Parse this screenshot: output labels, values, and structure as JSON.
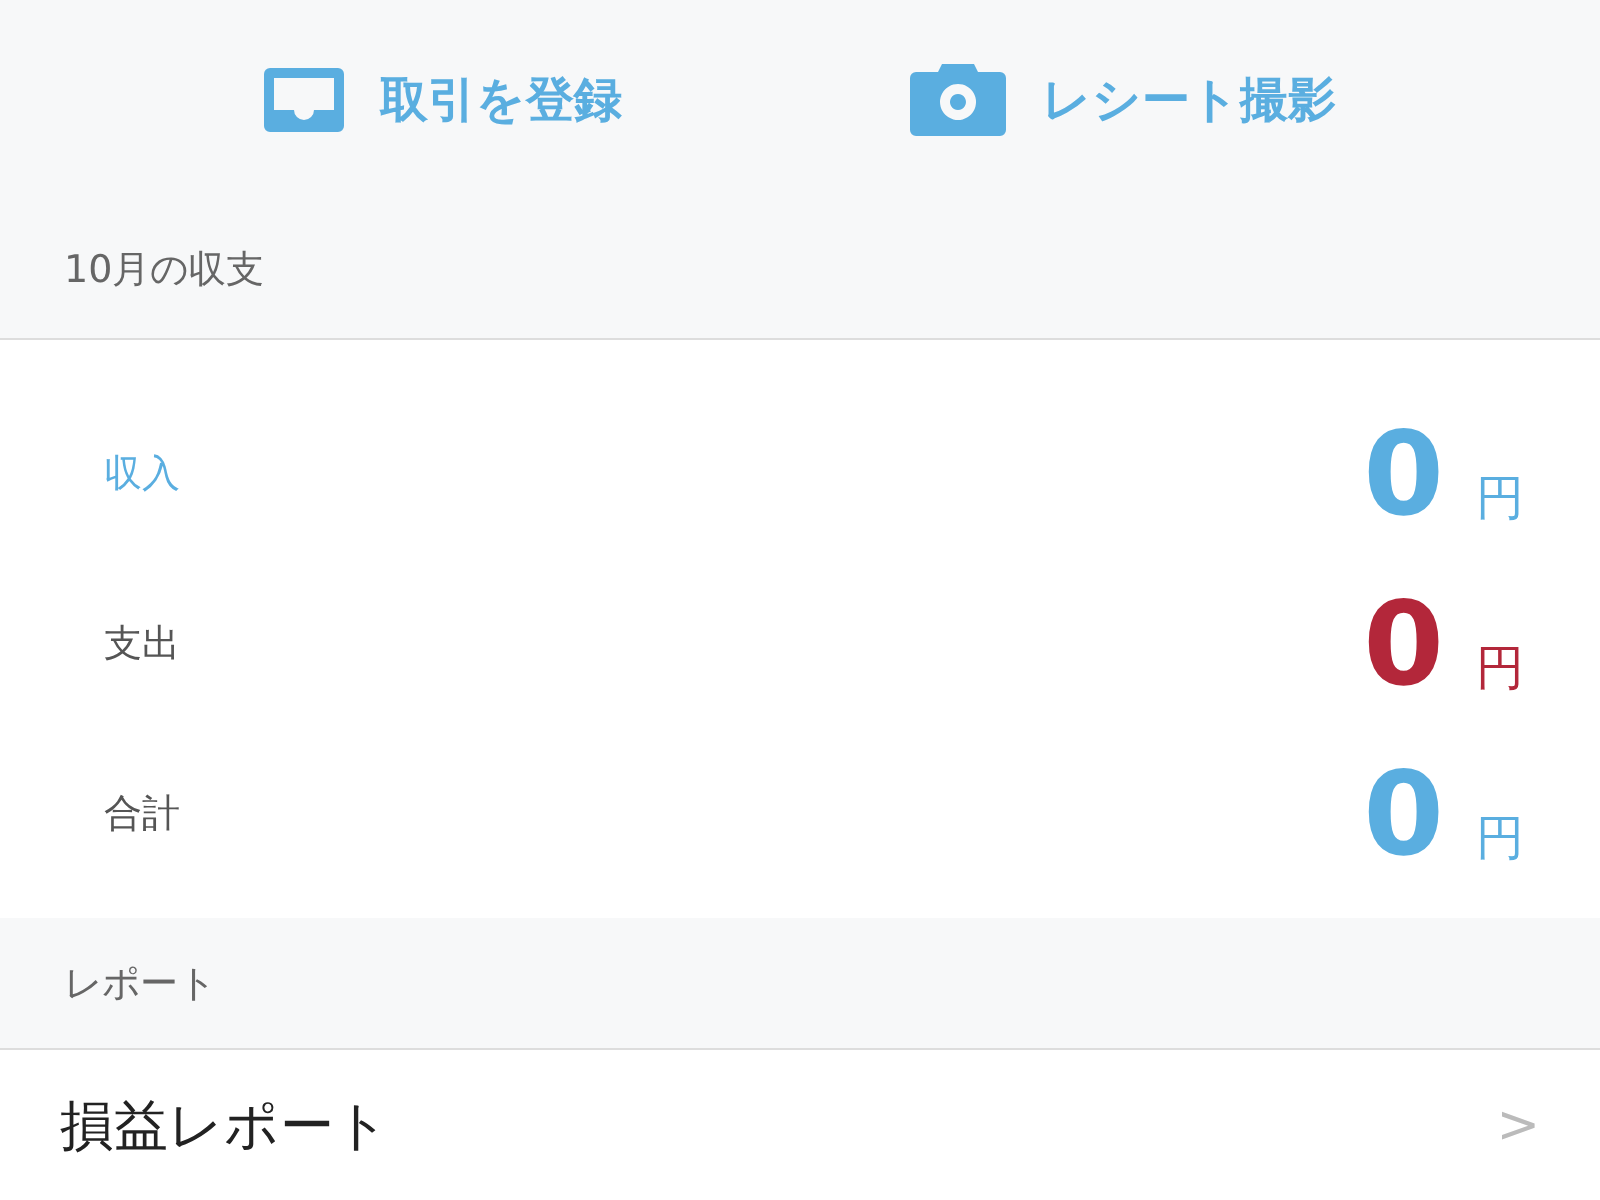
{
  "actions": [
    {
      "kind": "tray",
      "label": "取引を登録"
    },
    {
      "kind": "camera",
      "label": "レシート撮影"
    }
  ],
  "summary": {
    "title": "10月の収支",
    "rows": [
      {
        "kind": "income",
        "label": "収入",
        "amount": "0",
        "unit": "円",
        "color": "#5aaee0"
      },
      {
        "kind": "expense",
        "label": "支出",
        "amount": "0",
        "unit": "円",
        "color": "#b3273a"
      },
      {
        "kind": "total",
        "label": "合計",
        "amount": "0",
        "unit": "円",
        "color": "#5aaee0"
      }
    ]
  },
  "reports": {
    "title": "レポート",
    "items": [
      {
        "label": "損益レポート",
        "chevron": ">"
      }
    ]
  }
}
